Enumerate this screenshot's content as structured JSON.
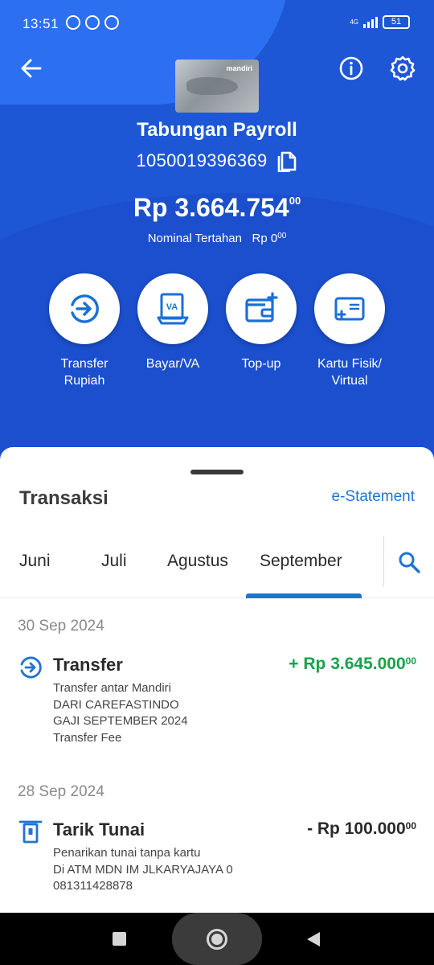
{
  "status_bar": {
    "time": "13:51",
    "network": "4G",
    "battery": "51"
  },
  "card": {
    "brand": "mandiri"
  },
  "account": {
    "name": "Tabungan Payroll",
    "number": "1050019396369",
    "balance_main": "Rp 3.664.754",
    "balance_decimal": "00",
    "held_label": "Nominal Tertahan",
    "held_amount": "Rp 0",
    "held_decimal": "00"
  },
  "actions": [
    {
      "label_line1": "Transfer",
      "label_line2": "Rupiah",
      "icon": "transfer-icon"
    },
    {
      "label_line1": "Bayar/VA",
      "label_line2": "",
      "icon": "va-icon"
    },
    {
      "label_line1": "Top-up",
      "label_line2": "",
      "icon": "wallet-icon"
    },
    {
      "label_line1": "Kartu Fisik/",
      "label_line2": "Virtual",
      "icon": "card-icon"
    }
  ],
  "transactions_section": {
    "title": "Transaksi",
    "estatement_label": "e-Statement",
    "tabs": [
      "Juni",
      "Juli",
      "Agustus",
      "September"
    ],
    "active_tab": "September"
  },
  "transactions": [
    {
      "date": "30 Sep 2024",
      "title": "Transfer",
      "amount": "+ Rp 3.645.000",
      "decimal": "00",
      "direction": "credit",
      "description": [
        "Transfer antar Mandiri",
        "DARI CAREFASTINDO",
        "GAJI SEPTEMBER 2024",
        "Transfer Fee"
      ]
    },
    {
      "date": "28 Sep 2024",
      "title": "Tarik Tunai",
      "amount": "- Rp 100.000",
      "decimal": "00",
      "direction": "debit",
      "description": [
        "Penarikan tunai tanpa kartu",
        "Di ATM MDN IM JLKARYAJAYA 0",
        "081311428878"
      ]
    }
  ],
  "colors": {
    "primary": "#1e57d6",
    "accent": "#1f73d6",
    "credit": "#16a34a"
  }
}
